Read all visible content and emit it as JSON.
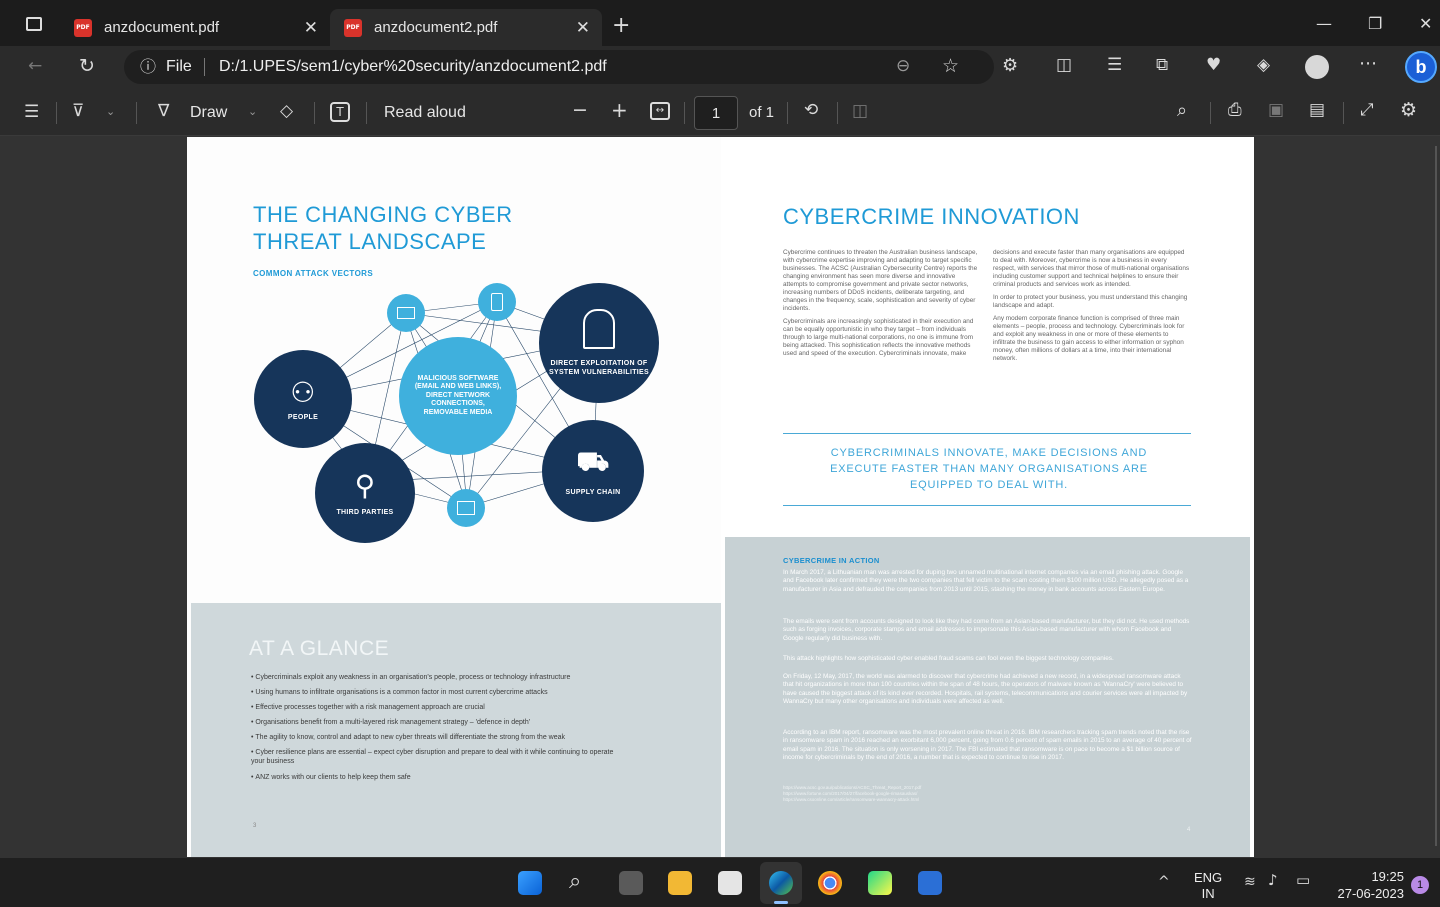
{
  "tabs": [
    {
      "title": "anzdocument.pdf",
      "icon": "pdf-file-icon"
    },
    {
      "title": "anzdocument2.pdf",
      "icon": "pdf-file-icon"
    }
  ],
  "address": {
    "scheme": "File",
    "url": "D:/1.UPES/sem1/cyber%20security/anzdocument2.pdf"
  },
  "pdf_toolbar": {
    "draw": "Draw",
    "read_aloud": "Read aloud",
    "page": "1",
    "of_pages": "of 1"
  },
  "left_page": {
    "title_line1": "THE CHANGING CYBER",
    "title_line2": "THREAT LANDSCAPE",
    "subtitle": "COMMON ATTACK VECTORS",
    "nodes": {
      "center": "MALICIOUS SOFTWARE (EMAIL AND WEB LINKS), DIRECT NETWORK CONNECTIONS, REMOVABLE MEDIA",
      "people": "PEOPLE",
      "third_parties": "THIRD PARTIES",
      "direct_exploitation": "DIRECT EXPLOITATION OF SYSTEM VULNERABILITIES",
      "supply_chain": "SUPPLY CHAIN"
    },
    "glance_title": "AT A GLANCE",
    "bullets": [
      "Cybercriminals exploit any weakness in an organisation's people, process or technology infrastructure",
      "Using humans to infiltrate organisations is a common factor in most current cybercrime attacks",
      "Effective processes together with a risk management approach are crucial",
      "Organisations benefit from a multi-layered risk management strategy – 'defence in depth'",
      "The agility to know, control and adapt to new cyber threats will differentiate the strong from the weak",
      "Cyber resilience plans are essential – expect cyber disruption and prepare to deal with it while continuing to operate your business",
      "ANZ works with our clients to help keep them safe"
    ],
    "page_no": "3"
  },
  "right_page": {
    "title": "CYBERCRIME INNOVATION",
    "col1": [
      "Cybercrime continues to threaten the Australian business landscape, with cybercrime expertise improving and adapting to target specific businesses. The ACSC (Australian Cybersecurity Centre) reports the changing environment has seen more diverse and innovative attempts to compromise government and private sector networks, increasing numbers of DDoS incidents, deliberate targeting, and changes in the frequency, scale, sophistication and severity of cyber incidents.",
      "Cybercriminals are increasingly sophisticated in their execution and can be equally opportunistic in who they target – from individuals through to large multi-national corporations, no one is immune from being attacked. This sophistication reflects the innovative methods used and speed of the execution. Cybercriminals innovate, make"
    ],
    "col2": [
      "decisions and execute faster than many organisations are equipped to deal with. Moreover, cybercrime is now a business in every respect, with services that mirror those of multi-national organisations including customer support and technical helplines to ensure their criminal products and services work as intended.",
      "In order to protect your business, you must understand this changing landscape and adapt.",
      "Any modern corporate finance function is comprised of three main elements – people, process and technology. Cybercriminals look for and exploit any weakness in one or more of these elements to infiltrate the business to gain access to either information or syphon money, often millions of dollars at a time, into their international network."
    ],
    "quote": "CYBERCRIMINALS INNOVATE, MAKE DECISIONS AND EXECUTE FASTER THAN MANY ORGANISATIONS ARE EQUIPPED TO DEAL WITH.",
    "action_title": "CYBERCRIME IN ACTION",
    "action_paras": [
      "In March 2017, a Lithuanian man was arrested for duping two unnamed multinational internet companies via an email phishing attack. Google and Facebook later confirmed they were the two companies that fell victim to the scam costing them $100 million USD. He allegedly posed as a manufacturer in Asia and defrauded the companies from 2013 until 2015, stashing the money in bank accounts across Eastern Europe.",
      "The emails were sent from accounts designed to look like they had come from an Asian-based manufacturer, but they did not. He used methods such as forging invoices, corporate stamps and email addresses to impersonate this Asian-based manufacturer with whom Facebook and Google regularly did business with.",
      "This attack highlights how sophisticated cyber enabled fraud scams can fool even the biggest technology companies.",
      "On Friday, 12 May, 2017, the world was alarmed to discover that cybercrime had achieved a new record, in a widespread ransomware attack that hit organizations in more than 100 countries within the span of 48 hours, the operators of malware known as 'WannaCry' were believed to have caused the biggest attack of its kind ever recorded. Hospitals, rail systems, telecommunications and courier services were all impacted by WannaCry but many other organisations and individuals were affected as well.",
      "According to an IBM report, ransomware was the most prevalent online threat in 2016. IBM researchers tracking spam trends noted that the rise in ransomware spam in 2016 reached an exorbitant 6,000 percent, going from 0.6 percent of spam emails in 2015 to an average of 40 percent of email spam in 2016. The situation is only worsening in 2017. The FBI estimated that ransomware is on pace to become a $1 billion source of income for cybercriminals by the end of 2016, a number that is expected to continue to rise in 2017."
    ],
    "footnotes": [
      "https://www.acsc.gov.au/publications/ACSC_Threat_Report_2017.pdf",
      "https://www.fortune.com/2017/04/27/facebook-google-rimasauskas/",
      "https://www.csoonline.com/article/ransomware-wannacry-attack.html"
    ],
    "page_no": "4"
  },
  "taskbar": {
    "lang": "ENG",
    "region": "IN",
    "time": "19:25",
    "date": "27-06-2023",
    "notif": "1"
  }
}
